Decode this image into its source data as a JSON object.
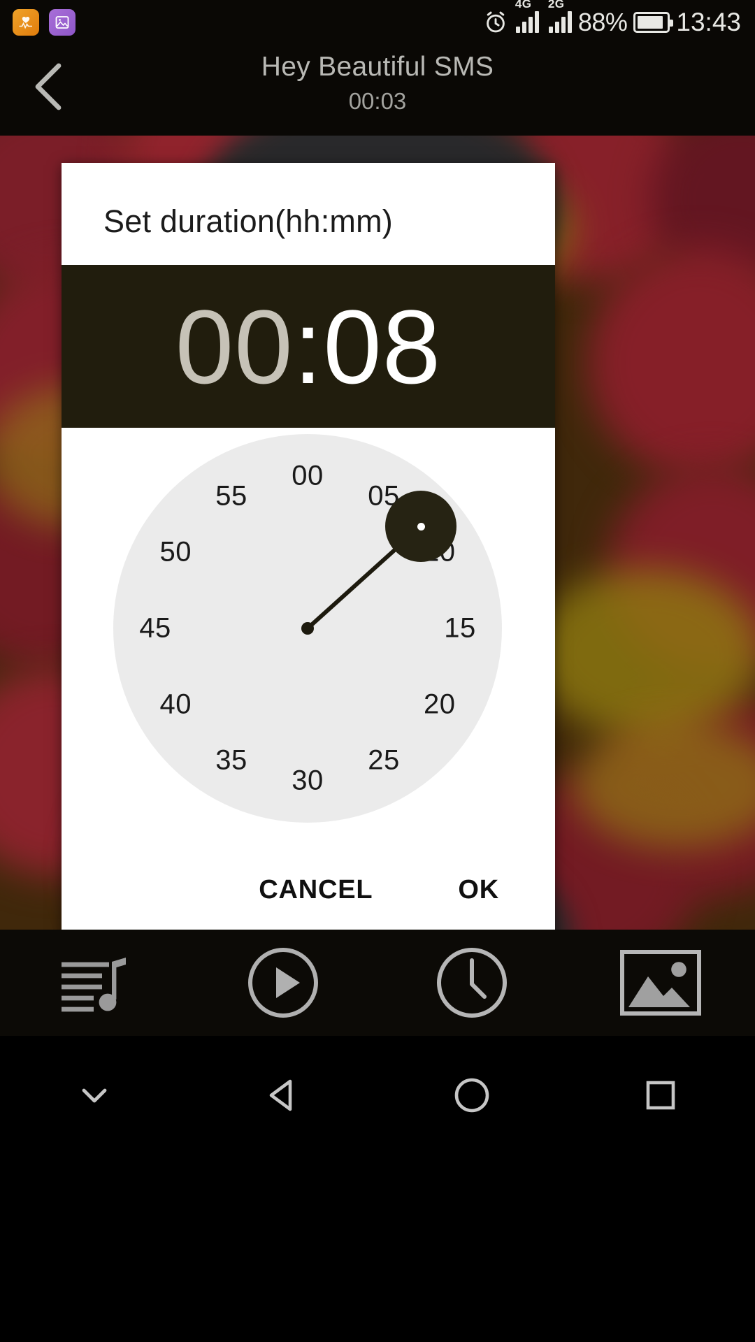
{
  "status_bar": {
    "notifications": [
      {
        "icon": "health-heartbeat-icon",
        "color": "#e8920f"
      },
      {
        "icon": "gallery-image-icon",
        "color": "#9a62ce"
      }
    ],
    "alarm_icon": "alarm-clock-icon",
    "sim1_network": "4G",
    "sim2_network": "2G",
    "battery_percent": "88%",
    "battery_level": 88,
    "time": "13:43"
  },
  "header": {
    "back_icon": "back-chevron-icon",
    "title": "Hey Beautiful SMS",
    "subtitle": "00:03"
  },
  "dialog": {
    "title": "Set duration(hh:mm)",
    "time": {
      "hours": "00",
      "separator": ":",
      "minutes": "08",
      "active_field": "minutes",
      "hours_color": "#c6c2b7",
      "minutes_color": "#ffffff",
      "background_color": "#211d0d"
    },
    "clock": {
      "mode": "minutes",
      "selected_value": "08",
      "selected_angle_deg": 48,
      "face_color": "#ebebeb",
      "selector_color": "#262313",
      "numbers": [
        "00",
        "05",
        "10",
        "15",
        "20",
        "25",
        "30",
        "35",
        "40",
        "45",
        "50",
        "55"
      ]
    },
    "actions": {
      "cancel": "CANCEL",
      "ok": "OK"
    }
  },
  "media_toolbar": {
    "buttons": [
      {
        "icon": "playlist-music-icon",
        "label": "Playlist"
      },
      {
        "icon": "play-circle-icon",
        "label": "Play"
      },
      {
        "icon": "clock-icon",
        "label": "Timer"
      },
      {
        "icon": "image-picture-icon",
        "label": "Artwork"
      }
    ]
  },
  "nav_bar": {
    "buttons": [
      {
        "icon": "hide-keyboard-chevron-icon"
      },
      {
        "icon": "back-triangle-icon"
      },
      {
        "icon": "home-circle-icon"
      },
      {
        "icon": "recents-square-icon"
      }
    ]
  }
}
